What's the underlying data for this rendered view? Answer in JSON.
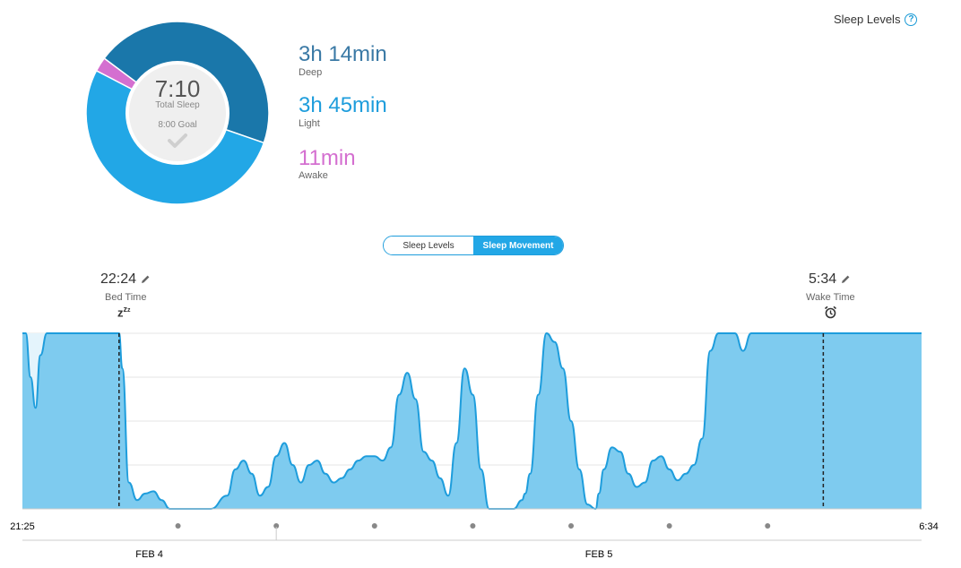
{
  "header": {
    "sleep_levels_link": "Sleep Levels",
    "help_icon": "?"
  },
  "summary": {
    "total_time": "7:10",
    "total_label": "Total Sleep",
    "goal_label": "8:00 Goal",
    "goal_met_icon": "check-icon",
    "stages": [
      {
        "name": "Deep",
        "duration": "3h 14min",
        "minutes": 194,
        "color": "#1a77aa"
      },
      {
        "name": "Light",
        "duration": "3h 45min",
        "minutes": 225,
        "color": "#22a7e6"
      },
      {
        "name": "Awake",
        "duration": "11min",
        "minutes": 11,
        "color": "#d46fd0"
      }
    ]
  },
  "toggle": {
    "options": [
      "Sleep Levels",
      "Sleep Movement"
    ],
    "selected": "Sleep Movement"
  },
  "markers": {
    "bed": {
      "time": "22:24",
      "label": "Bed Time",
      "icon": "zzz-icon"
    },
    "wake": {
      "time": "5:34",
      "label": "Wake Time",
      "icon": "alarm-clock-icon"
    }
  },
  "chart_data": {
    "type": "area",
    "title": "",
    "xlabel": "",
    "ylabel": "",
    "x_start": "21:25",
    "x_end": "6:34",
    "date_labels": [
      "FEB 4",
      "FEB 5"
    ],
    "ylim": [
      0,
      4
    ],
    "grid": true,
    "bed_time": "22:24",
    "wake_time": "5:34",
    "x": [
      "21:25",
      "21:27",
      "21:30",
      "21:33",
      "21:36",
      "21:40",
      "21:45",
      "22:24",
      "22:26",
      "22:30",
      "22:35",
      "22:40",
      "22:45",
      "22:50",
      "22:55",
      "23:00",
      "23:10",
      "23:20",
      "23:30",
      "23:35",
      "23:40",
      "23:45",
      "23:50",
      "23:55",
      "0:00",
      "0:05",
      "0:10",
      "0:15",
      "0:20",
      "0:25",
      "0:30",
      "0:35",
      "0:40",
      "0:45",
      "0:50",
      "0:55",
      "1:00",
      "1:05",
      "1:10",
      "1:15",
      "1:20",
      "1:25",
      "1:30",
      "1:35",
      "1:40",
      "1:45",
      "1:50",
      "1:55",
      "2:00",
      "2:05",
      "2:10",
      "2:15",
      "2:20",
      "2:25",
      "2:30",
      "2:32",
      "2:35",
      "2:40",
      "2:45",
      "2:50",
      "2:55",
      "3:00",
      "3:05",
      "3:10",
      "3:15",
      "3:17",
      "3:20",
      "3:25",
      "3:30",
      "3:35",
      "3:40",
      "3:45",
      "3:50",
      "3:55",
      "4:00",
      "4:05",
      "4:10",
      "4:15",
      "4:20",
      "4:25",
      "4:30",
      "4:35",
      "4:40",
      "4:45",
      "4:50",
      "4:55",
      "5:00",
      "5:05",
      "5:10",
      "5:15",
      "5:20",
      "5:25",
      "5:30",
      "5:34",
      "5:36",
      "5:40",
      "5:45",
      "5:50",
      "5:55",
      "6:00",
      "6:10",
      "6:20",
      "6:34"
    ],
    "values": [
      4,
      4,
      3,
      2.3,
      3.5,
      4,
      4,
      4,
      3.2,
      0.6,
      0.2,
      0.35,
      0.4,
      0.2,
      0,
      0,
      0,
      0,
      0.3,
      0.9,
      1.1,
      0.8,
      0.3,
      0.5,
      1.2,
      1.5,
      1,
      0.6,
      1,
      1.1,
      0.8,
      0.6,
      0.7,
      0.9,
      1.1,
      1.2,
      1.2,
      1.1,
      1.4,
      2.6,
      3.1,
      2.5,
      1.3,
      1.1,
      0.7,
      0.3,
      1.5,
      3.2,
      2.6,
      0.9,
      0,
      0,
      0,
      0,
      0.2,
      0.35,
      0.8,
      2.6,
      4,
      3.8,
      3.2,
      2,
      0.9,
      0.1,
      0,
      0.35,
      0.9,
      1.4,
      1.3,
      0.8,
      0.5,
      0.6,
      1.1,
      1.2,
      0.9,
      0.65,
      0.8,
      1,
      1.6,
      3.6,
      4,
      4,
      4,
      3.6,
      4,
      4,
      4,
      4,
      4,
      4,
      4,
      4,
      4,
      4,
      4,
      4,
      4,
      4,
      4,
      4,
      4,
      4,
      4
    ]
  }
}
